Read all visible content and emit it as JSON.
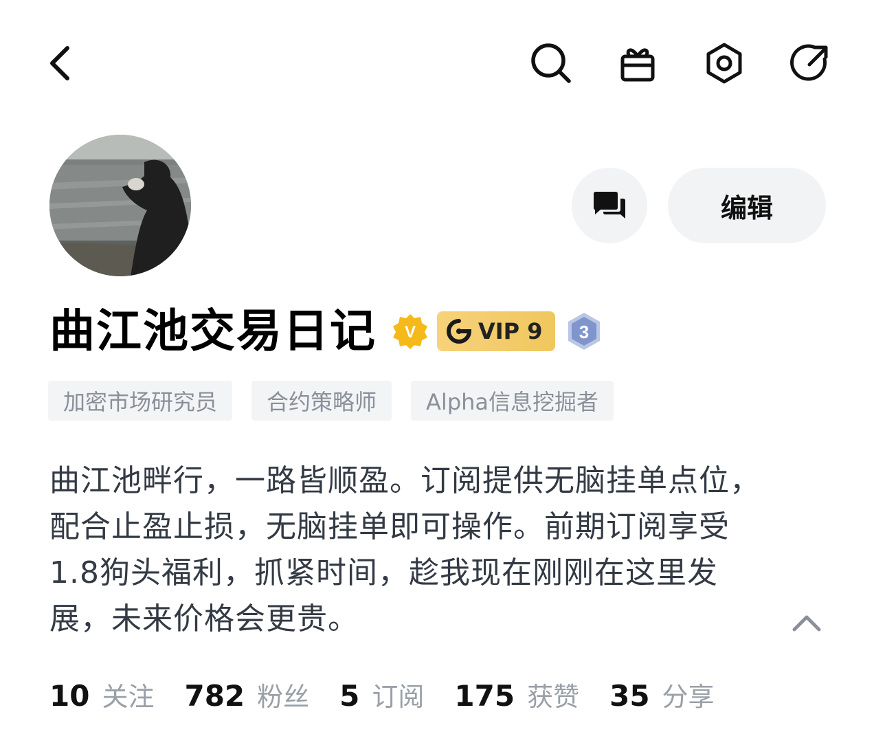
{
  "header": {
    "back_icon": "chevron-left-icon",
    "actions": [
      "search-icon",
      "gift-icon",
      "settings-icon",
      "share-icon"
    ]
  },
  "profile": {
    "avatar": "profile-photo",
    "name": "曲江池交易日记",
    "verified_label": "V",
    "vip_label": "VIP 9",
    "level": "3",
    "message_icon": "chat-icon",
    "edit_label": "编辑"
  },
  "tags": [
    "加密市场研究员",
    "合约策略师",
    "Alpha信息挖掘者"
  ],
  "bio": {
    "lines": [
      "曲江池畔行，一路皆顺盈。订阅提供无脑挂单点位，",
      "配合止盈止损，无脑挂单即可操作。前期订阅享受",
      "1.8狗头福利，抓紧时间，趁我现在刚刚在这里发",
      "展，未来价格会更贵。"
    ],
    "collapse_icon": "chevron-up-icon"
  },
  "stats": [
    {
      "value": "10",
      "label": "关注"
    },
    {
      "value": "782",
      "label": "粉丝"
    },
    {
      "value": "5",
      "label": "订阅"
    },
    {
      "value": "175",
      "label": "获赞"
    },
    {
      "value": "35",
      "label": "分享"
    }
  ],
  "colors": {
    "accent_gold": "#f0c75e",
    "verified_gold": "#f5b91a",
    "button_bg": "#f2f3f5",
    "tag_bg": "#f3f4f6",
    "muted_text": "#9aa0a8"
  }
}
